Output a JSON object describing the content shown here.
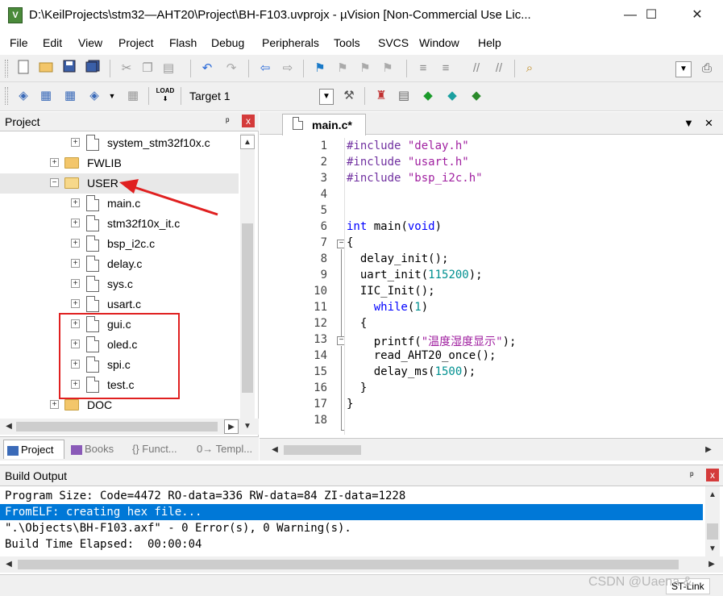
{
  "window": {
    "title": "D:\\KeilProjects\\stm32—AHT20\\Project\\BH-F103.uvprojx - µVision  [Non-Commercial Use Lic...",
    "app_icon": "V",
    "minimize": "—",
    "maximize": "☐",
    "close": "✕"
  },
  "menu": [
    "File",
    "Edit",
    "View",
    "Project",
    "Flash",
    "Debug",
    "Peripherals",
    "Tools",
    "SVCS",
    "Window",
    "Help"
  ],
  "toolbar2": {
    "target_label": "Target 1"
  },
  "project_panel": {
    "title": "Project",
    "pin": "ᵖ",
    "close": "x",
    "tree": [
      {
        "label": "system_stm32f10x.c",
        "kind": "file"
      },
      {
        "label": "FWLIB",
        "kind": "folder"
      },
      {
        "label": "USER",
        "kind": "folder-open"
      },
      {
        "label": "main.c",
        "kind": "file"
      },
      {
        "label": "stm32f10x_it.c",
        "kind": "file"
      },
      {
        "label": "bsp_i2c.c",
        "kind": "file"
      },
      {
        "label": "delay.c",
        "kind": "file"
      },
      {
        "label": "sys.c",
        "kind": "file"
      },
      {
        "label": "usart.c",
        "kind": "file"
      },
      {
        "label": "gui.c",
        "kind": "file"
      },
      {
        "label": "oled.c",
        "kind": "file"
      },
      {
        "label": "spi.c",
        "kind": "file"
      },
      {
        "label": "test.c",
        "kind": "file"
      },
      {
        "label": "DOC",
        "kind": "folder"
      }
    ],
    "tabs": [
      "Project",
      "Books",
      "{} Funct...",
      "0→ Templ..."
    ]
  },
  "editor": {
    "tab_label": "main.c*",
    "line_numbers": [
      "1",
      "2",
      "3",
      "4",
      "5",
      "6",
      "7",
      "8",
      "9",
      "10",
      "11",
      "12",
      "13",
      "14",
      "15",
      "16",
      "17",
      "18"
    ],
    "code": {
      "l1_a": "#include ",
      "l1_b": "\"delay.h\"",
      "l2_a": "#include ",
      "l2_b": "\"usart.h\"",
      "l3_a": "#include ",
      "l3_b": "\"bsp_i2c.h\"",
      "l6_a": "int",
      "l6_b": " main(",
      "l6_c": "void",
      "l6_d": ")",
      "l7": "{",
      "l8": "  delay_init();",
      "l9_a": "  uart_init(",
      "l9_b": "115200",
      "l9_c": ");",
      "l10": "  IIC_Init();",
      "l11_a": "    while",
      "l11_b": "(",
      "l11_c": "1",
      "l11_d": ")",
      "l12": "  {",
      "l13_a": "    printf(",
      "l13_b": "\"温度湿度显示\"",
      "l13_c": ");",
      "l14": "    read_AHT20_once();",
      "l15_a": "    delay_ms(",
      "l15_b": "1500",
      "l15_c": ");",
      "l16": "  }",
      "l17": "}"
    }
  },
  "build_output": {
    "title": "Build Output",
    "lines": [
      "Program Size: Code=4472 RO-data=336 RW-data=84 ZI-data=1228",
      "FromELF: creating hex file...",
      "\".\\Objects\\BH-F103.axf\" - 0 Error(s), 0 Warning(s).",
      "Build Time Elapsed:  00:00:04"
    ]
  },
  "status": {
    "debugger": "ST-Link",
    "watermark": "CSDN @Uaena &"
  },
  "colors": {
    "selection": "#0078d7",
    "annotation_red": "#e02020",
    "current_line": "#e6f9e6"
  }
}
